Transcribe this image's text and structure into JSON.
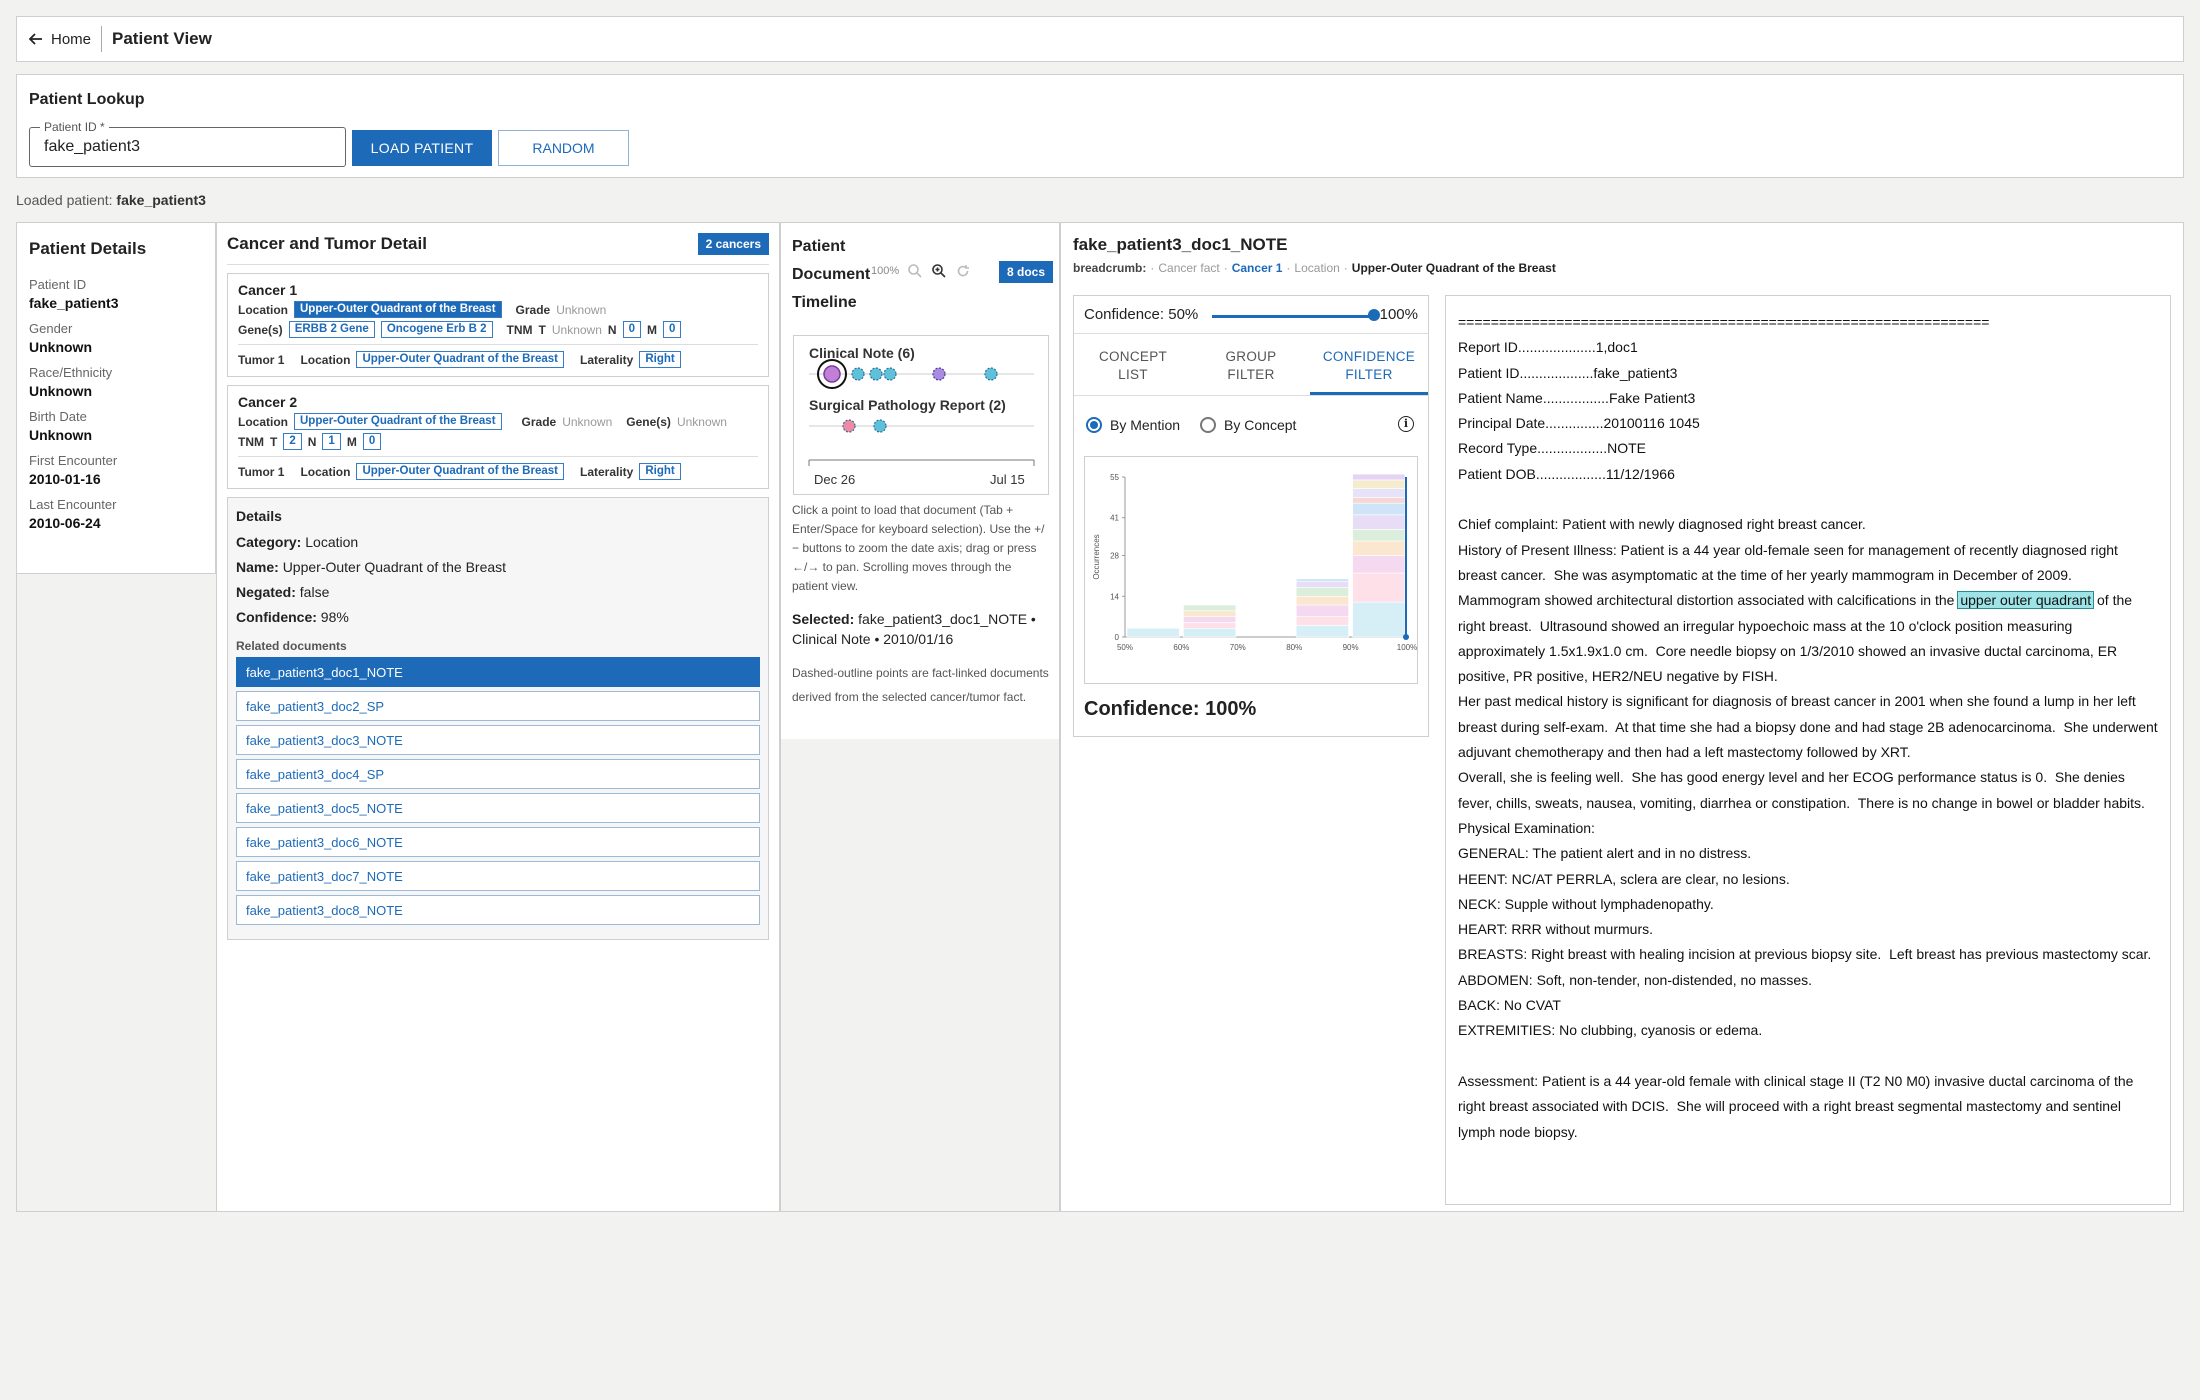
{
  "topbar": {
    "home_label": "Home",
    "title": "Patient View"
  },
  "lookup": {
    "heading": "Patient Lookup",
    "field_label": "Patient ID *",
    "field_value": "fake_patient3",
    "load_label": "LOAD PATIENT",
    "random_label": "RANDOM"
  },
  "loaded": {
    "prefix": "Loaded patient:",
    "id": "fake_patient3"
  },
  "patient": {
    "heading": "Patient Details",
    "fields": [
      {
        "label": "Patient ID",
        "value": "fake_patient3"
      },
      {
        "label": "Gender",
        "value": "Unknown"
      },
      {
        "label": "Race/Ethnicity",
        "value": "Unknown"
      },
      {
        "label": "Birth Date",
        "value": "Unknown"
      },
      {
        "label": "First Encounter",
        "value": "2010-01-16"
      },
      {
        "label": "Last Encounter",
        "value": "2010-06-24"
      }
    ]
  },
  "cancer": {
    "heading": "Cancer and Tumor Detail",
    "badge": "2 cancers",
    "c1": {
      "title": "Cancer 1",
      "location_label": "Location",
      "location": "Upper-Outer Quadrant of the Breast",
      "grade_label": "Grade",
      "grade": "Unknown",
      "genes_label": "Gene(s)",
      "gene1": "ERBB 2 Gene",
      "gene2": "Oncogene Erb B 2",
      "tnm_label": "TNM",
      "t_label": "T",
      "t": "Unknown",
      "n_label": "N",
      "n": "0",
      "m_label": "M",
      "m": "0",
      "tumor_label": "Tumor 1",
      "tumor_loc_label": "Location",
      "tumor_loc": "Upper-Outer Quadrant of the Breast",
      "lat_label": "Laterality",
      "lat": "Right"
    },
    "c2": {
      "title": "Cancer 2",
      "location_label": "Location",
      "location": "Upper-Outer Quadrant of the Breast",
      "grade_label": "Grade",
      "grade": "Unknown",
      "genes_label": "Gene(s)",
      "genes": "Unknown",
      "tnm_label": "TNM",
      "t_label": "T",
      "t": "2",
      "n_label": "N",
      "n": "1",
      "m_label": "M",
      "m": "0",
      "tumor_label": "Tumor 1",
      "tumor_loc_label": "Location",
      "tumor_loc": "Upper-Outer Quadrant of the Breast",
      "lat_label": "Laterality",
      "lat": "Right"
    },
    "details": {
      "heading": "Details",
      "category_label": "Category:",
      "category": "Location",
      "name_label": "Name:",
      "name": "Upper-Outer Quadrant of the Breast",
      "negated_label": "Negated:",
      "negated": "false",
      "confidence_label": "Confidence:",
      "confidence": "98%",
      "related_label": "Related documents",
      "docs": [
        "fake_patient3_doc1_NOTE",
        "fake_patient3_doc2_SP",
        "fake_patient3_doc3_NOTE",
        "fake_patient3_doc4_SP",
        "fake_patient3_doc5_NOTE",
        "fake_patient3_doc6_NOTE",
        "fake_patient3_doc7_NOTE",
        "fake_patient3_doc8_NOTE"
      ]
    }
  },
  "timeline": {
    "title_lines": [
      "Patient",
      "Document",
      "Timeline"
    ],
    "zoom": "100%",
    "badge": "8 docs",
    "lane1": "Clinical Note (6)",
    "lane2": "Surgical Pathology Report (2)",
    "axis_start": "Dec 26",
    "axis_end": "Jul 15",
    "help": "Click a point to load that document (Tab + Enter/Space for keyboard selection). Use the +/− buttons to zoom the date axis; drag or press ←/→ to pan. Scrolling moves through the patient view.",
    "selected_label": "Selected:",
    "selected_value": "fake_patient3_doc1_NOTE • Clinical Note • 2010/01/16",
    "note": "Dashed-outline points are fact-linked documents derived from the selected cancer/tumor fact."
  },
  "document": {
    "title": "fake_patient3_doc1_NOTE",
    "crumb_label": "breadcrumb:",
    "crumbs": [
      "Cancer fact",
      "Cancer 1",
      "Location",
      "Upper-Outer Quadrant of the Breast"
    ],
    "confidence_label": "Confidence: 50%",
    "confidence_max": "100%",
    "slider_value": 1.0,
    "tabs": [
      "CONCEPT\nLIST",
      "GROUP\nFILTER",
      "CONFIDENCE\nFILTER"
    ],
    "radio_mention": "By Mention",
    "radio_concept": "By Concept",
    "confidence_big": "Confidence: 100%",
    "report_lines": [
      "=================================================================",
      "Report ID....................1,doc1",
      "Patient ID...................fake_patient3",
      "Patient Name.................Fake Patient3",
      "Principal Date...............20100116 1045",
      "Record Type..................NOTE",
      "Patient DOB..................11/12/1966",
      "",
      "Chief complaint: Patient with newly diagnosed right breast cancer.",
      "History of Present Illness: Patient is a 44 year old-female seen for management of recently diagnosed right",
      "breast cancer.  She was asymptomatic at the time of her yearly mammogram in December of 2009."
    ],
    "mammo_before": "Mammogram showed architectural distortion associated with calcifications in the ",
    "mammo_highlight": "upper outer quadrant",
    "mammo_after": " of the",
    "report_lines2": [
      "right breast.  Ultrasound showed an irregular hypoechoic mass at the 10 o'clock position measuring",
      "approximately 1.5x1.9x1.0 cm.  Core needle biopsy on 1/3/2010 showed an invasive ductal carcinoma, ER",
      "positive, PR positive, HER2/NEU negative by FISH.",
      "Her past medical history is significant for diagnosis of breast cancer in 2001 when she found a lump in her left",
      "breast during self-exam.  At that time she had a biopsy done and had stage 2B adenocarcinoma.  She underwent",
      "adjuvant chemotherapy and then had a left mastectomy followed by XRT.",
      "Overall, she is feeling well.  She has good energy level and her ECOG performance status is 0.  She denies",
      "fever, chills, sweats, nausea, vomiting, diarrhea or constipation.  There is no change in bowel or bladder habits.",
      "Physical Examination:",
      "GENERAL: The patient alert and in no distress.",
      "HEENT: NC/AT PERRLA, sclera are clear, no lesions.",
      "NECK: Supple without lymphadenopathy.",
      "HEART: RRR without murmurs.",
      "BREASTS: Right breast with healing incision at previous biopsy site.  Left breast has previous mastectomy scar.",
      "ABDOMEN: Soft, non-tender, non-distended, no masses.",
      "BACK: No CVAT",
      "EXTREMITIES: No clubbing, cyanosis or edema.",
      "",
      "Assessment: Patient is a 44 year-old female with clinical stage II (T2 N0 M0) invasive ductal carcinoma of the",
      "right breast associated with DCIS.  She will proceed with a right breast segmental mastectomy and sentinel",
      "lymph node biopsy."
    ]
  },
  "chart_data": {
    "type": "bar",
    "ylabel": "Occurrences",
    "x_ticks": [
      "50%",
      "60%",
      "70%",
      "80%",
      "90%",
      "100%"
    ],
    "y_ticks": [
      "0",
      "14",
      "28",
      "41",
      "55"
    ],
    "ylim": [
      0,
      55
    ],
    "bins": [
      {
        "x": "50%",
        "values": [
          3
        ]
      },
      {
        "x": "60%",
        "values": [
          3,
          2,
          2,
          2,
          2
        ]
      },
      {
        "x": "80%",
        "values": [
          4,
          3,
          4,
          3,
          3,
          2,
          1
        ]
      },
      {
        "x": "90%",
        "values": [
          12,
          10,
          6,
          5,
          4,
          5,
          4,
          2,
          3,
          3,
          2
        ]
      }
    ],
    "colors": [
      "#d6eef5",
      "#fde0e8",
      "#f4d9f0",
      "#fbe6cf",
      "#dbeedb",
      "#e8ddf6",
      "#cfe4f7",
      "#f7d6d6",
      "#e6e2f8",
      "#f5ecd0",
      "#e4d3f3"
    ]
  }
}
